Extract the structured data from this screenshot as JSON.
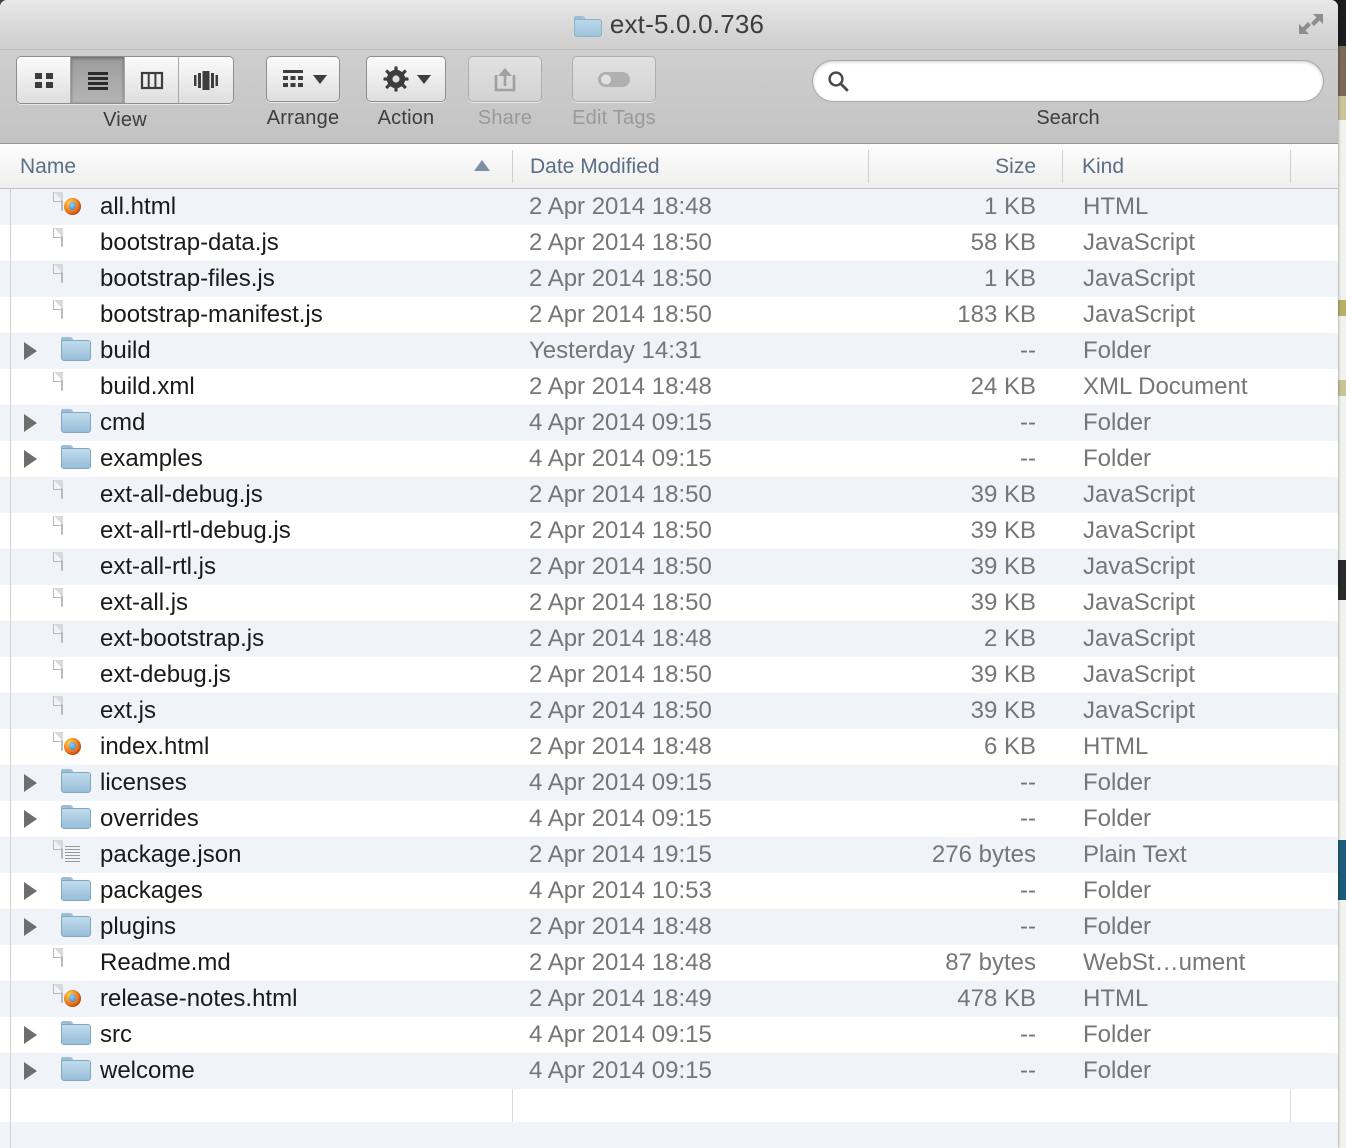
{
  "window": {
    "title": "ext-5.0.0.736",
    "folder_icon": "folder-icon",
    "fullscreen_icon": "fullscreen-arrows-icon"
  },
  "toolbar": {
    "view": {
      "caption": "View",
      "segments": [
        {
          "name": "icon-view",
          "icon": "grid-icon",
          "active": false
        },
        {
          "name": "list-view",
          "icon": "list-icon",
          "active": true
        },
        {
          "name": "column-view",
          "icon": "columns-icon",
          "active": false
        },
        {
          "name": "coverflow-view",
          "icon": "coverflow-icon",
          "active": false
        }
      ]
    },
    "arrange": {
      "caption": "Arrange",
      "icon": "arrange-grid-icon",
      "disabled": false
    },
    "action": {
      "caption": "Action",
      "icon": "gear-icon",
      "disabled": false
    },
    "share": {
      "caption": "Share",
      "icon": "share-arrow-icon",
      "disabled": true
    },
    "edit_tags": {
      "caption": "Edit Tags",
      "icon": "tag-pill-icon",
      "disabled": true
    },
    "search": {
      "caption": "Search",
      "icon": "search-icon",
      "value": "",
      "placeholder": ""
    }
  },
  "columns": {
    "name": "Name",
    "date_modified": "Date Modified",
    "size": "Size",
    "kind": "Kind",
    "sort_column": "Name",
    "sort_direction": "ascending",
    "sort_icon": "sort-ascending-triangle-icon"
  },
  "colors": {
    "row_stripe": "#f0f4f9",
    "row_plain": "#ffffff",
    "header_text": "#5b6e84",
    "primary_text": "#1a1a1a",
    "secondary_text": "#767676",
    "folder_blue": "#96bdd8"
  },
  "files": [
    {
      "name": "all.html",
      "date": "2 Apr 2014 18:48",
      "size": "1 KB",
      "kind": "HTML",
      "icon": "html-document-icon",
      "expandable": false
    },
    {
      "name": "bootstrap-data.js",
      "date": "2 Apr 2014 18:50",
      "size": "58 KB",
      "kind": "JavaScript",
      "icon": "blank-document-icon",
      "expandable": false
    },
    {
      "name": "bootstrap-files.js",
      "date": "2 Apr 2014 18:50",
      "size": "1 KB",
      "kind": "JavaScript",
      "icon": "blank-document-icon",
      "expandable": false
    },
    {
      "name": "bootstrap-manifest.js",
      "date": "2 Apr 2014 18:50",
      "size": "183 KB",
      "kind": "JavaScript",
      "icon": "blank-document-icon",
      "expandable": false
    },
    {
      "name": "build",
      "date": "Yesterday 14:31",
      "size": "--",
      "kind": "Folder",
      "icon": "folder-icon",
      "expandable": true
    },
    {
      "name": "build.xml",
      "date": "2 Apr 2014 18:48",
      "size": "24 KB",
      "kind": "XML Document",
      "icon": "blank-document-icon",
      "expandable": false
    },
    {
      "name": "cmd",
      "date": "4 Apr 2014 09:15",
      "size": "--",
      "kind": "Folder",
      "icon": "folder-icon",
      "expandable": true
    },
    {
      "name": "examples",
      "date": "4 Apr 2014 09:15",
      "size": "--",
      "kind": "Folder",
      "icon": "folder-icon",
      "expandable": true
    },
    {
      "name": "ext-all-debug.js",
      "date": "2 Apr 2014 18:50",
      "size": "39 KB",
      "kind": "JavaScript",
      "icon": "blank-document-icon",
      "expandable": false
    },
    {
      "name": "ext-all-rtl-debug.js",
      "date": "2 Apr 2014 18:50",
      "size": "39 KB",
      "kind": "JavaScript",
      "icon": "blank-document-icon",
      "expandable": false
    },
    {
      "name": "ext-all-rtl.js",
      "date": "2 Apr 2014 18:50",
      "size": "39 KB",
      "kind": "JavaScript",
      "icon": "blank-document-icon",
      "expandable": false
    },
    {
      "name": "ext-all.js",
      "date": "2 Apr 2014 18:50",
      "size": "39 KB",
      "kind": "JavaScript",
      "icon": "blank-document-icon",
      "expandable": false
    },
    {
      "name": "ext-bootstrap.js",
      "date": "2 Apr 2014 18:48",
      "size": "2 KB",
      "kind": "JavaScript",
      "icon": "blank-document-icon",
      "expandable": false
    },
    {
      "name": "ext-debug.js",
      "date": "2 Apr 2014 18:50",
      "size": "39 KB",
      "kind": "JavaScript",
      "icon": "blank-document-icon",
      "expandable": false
    },
    {
      "name": "ext.js",
      "date": "2 Apr 2014 18:50",
      "size": "39 KB",
      "kind": "JavaScript",
      "icon": "blank-document-icon",
      "expandable": false
    },
    {
      "name": "index.html",
      "date": "2 Apr 2014 18:48",
      "size": "6 KB",
      "kind": "HTML",
      "icon": "html-document-icon",
      "expandable": false
    },
    {
      "name": "licenses",
      "date": "4 Apr 2014 09:15",
      "size": "--",
      "kind": "Folder",
      "icon": "folder-icon",
      "expandable": true
    },
    {
      "name": "overrides",
      "date": "4 Apr 2014 09:15",
      "size": "--",
      "kind": "Folder",
      "icon": "folder-icon",
      "expandable": true
    },
    {
      "name": "package.json",
      "date": "2 Apr 2014 19:15",
      "size": "276 bytes",
      "kind": "Plain Text",
      "icon": "text-document-icon",
      "expandable": false
    },
    {
      "name": "packages",
      "date": "4 Apr 2014 10:53",
      "size": "--",
      "kind": "Folder",
      "icon": "folder-icon",
      "expandable": true
    },
    {
      "name": "plugins",
      "date": "2 Apr 2014 18:48",
      "size": "--",
      "kind": "Folder",
      "icon": "folder-icon",
      "expandable": true
    },
    {
      "name": "Readme.md",
      "date": "2 Apr 2014 18:48",
      "size": "87 bytes",
      "kind": "WebSt…ument",
      "icon": "blank-document-icon",
      "expandable": false
    },
    {
      "name": "release-notes.html",
      "date": "2 Apr 2014 18:49",
      "size": "478 KB",
      "kind": "HTML",
      "icon": "html-document-icon",
      "expandable": false
    },
    {
      "name": "src",
      "date": "4 Apr 2014 09:15",
      "size": "--",
      "kind": "Folder",
      "icon": "folder-icon",
      "expandable": true
    },
    {
      "name": "welcome",
      "date": "4 Apr 2014 09:15",
      "size": "--",
      "kind": "Folder",
      "icon": "folder-icon",
      "expandable": true
    }
  ]
}
